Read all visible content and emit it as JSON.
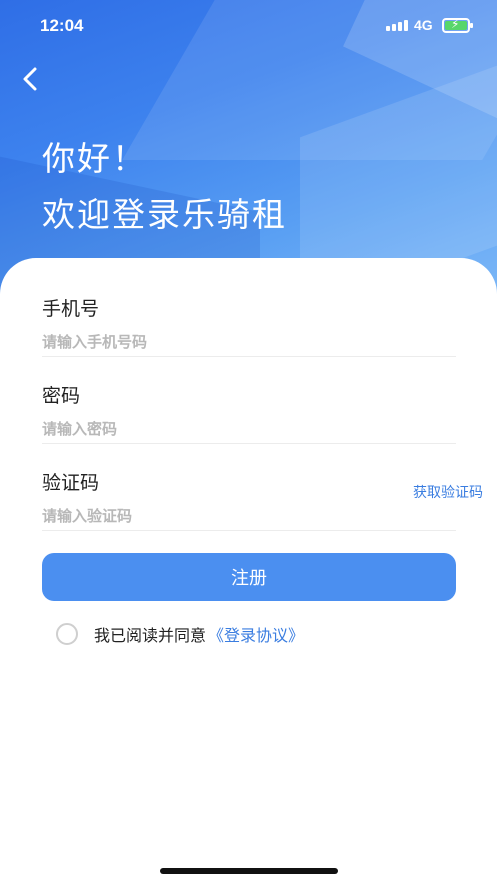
{
  "status_bar": {
    "time": "12:04",
    "network": "4G"
  },
  "header": {
    "greeting_line1": "你好！",
    "greeting_line2": "欢迎登录乐骑租"
  },
  "form": {
    "phone": {
      "label": "手机号",
      "placeholder": "请输入手机号码",
      "value": ""
    },
    "password": {
      "label": "密码",
      "placeholder": "请输入密码",
      "value": ""
    },
    "code": {
      "label": "验证码",
      "placeholder": "请输入验证码",
      "value": "",
      "get_code_label": "获取验证码"
    }
  },
  "register_button": {
    "label": "注册"
  },
  "agreement": {
    "text": "我已阅读并同意",
    "link": "《登录协议》",
    "checked": false
  },
  "colors": {
    "accent": "#4b8ff0",
    "link": "#3a7de0",
    "battery": "#58d66a"
  },
  "icons": {
    "back": "chevron-left-icon",
    "signal": "signal-icon",
    "battery": "battery-charging-icon"
  }
}
